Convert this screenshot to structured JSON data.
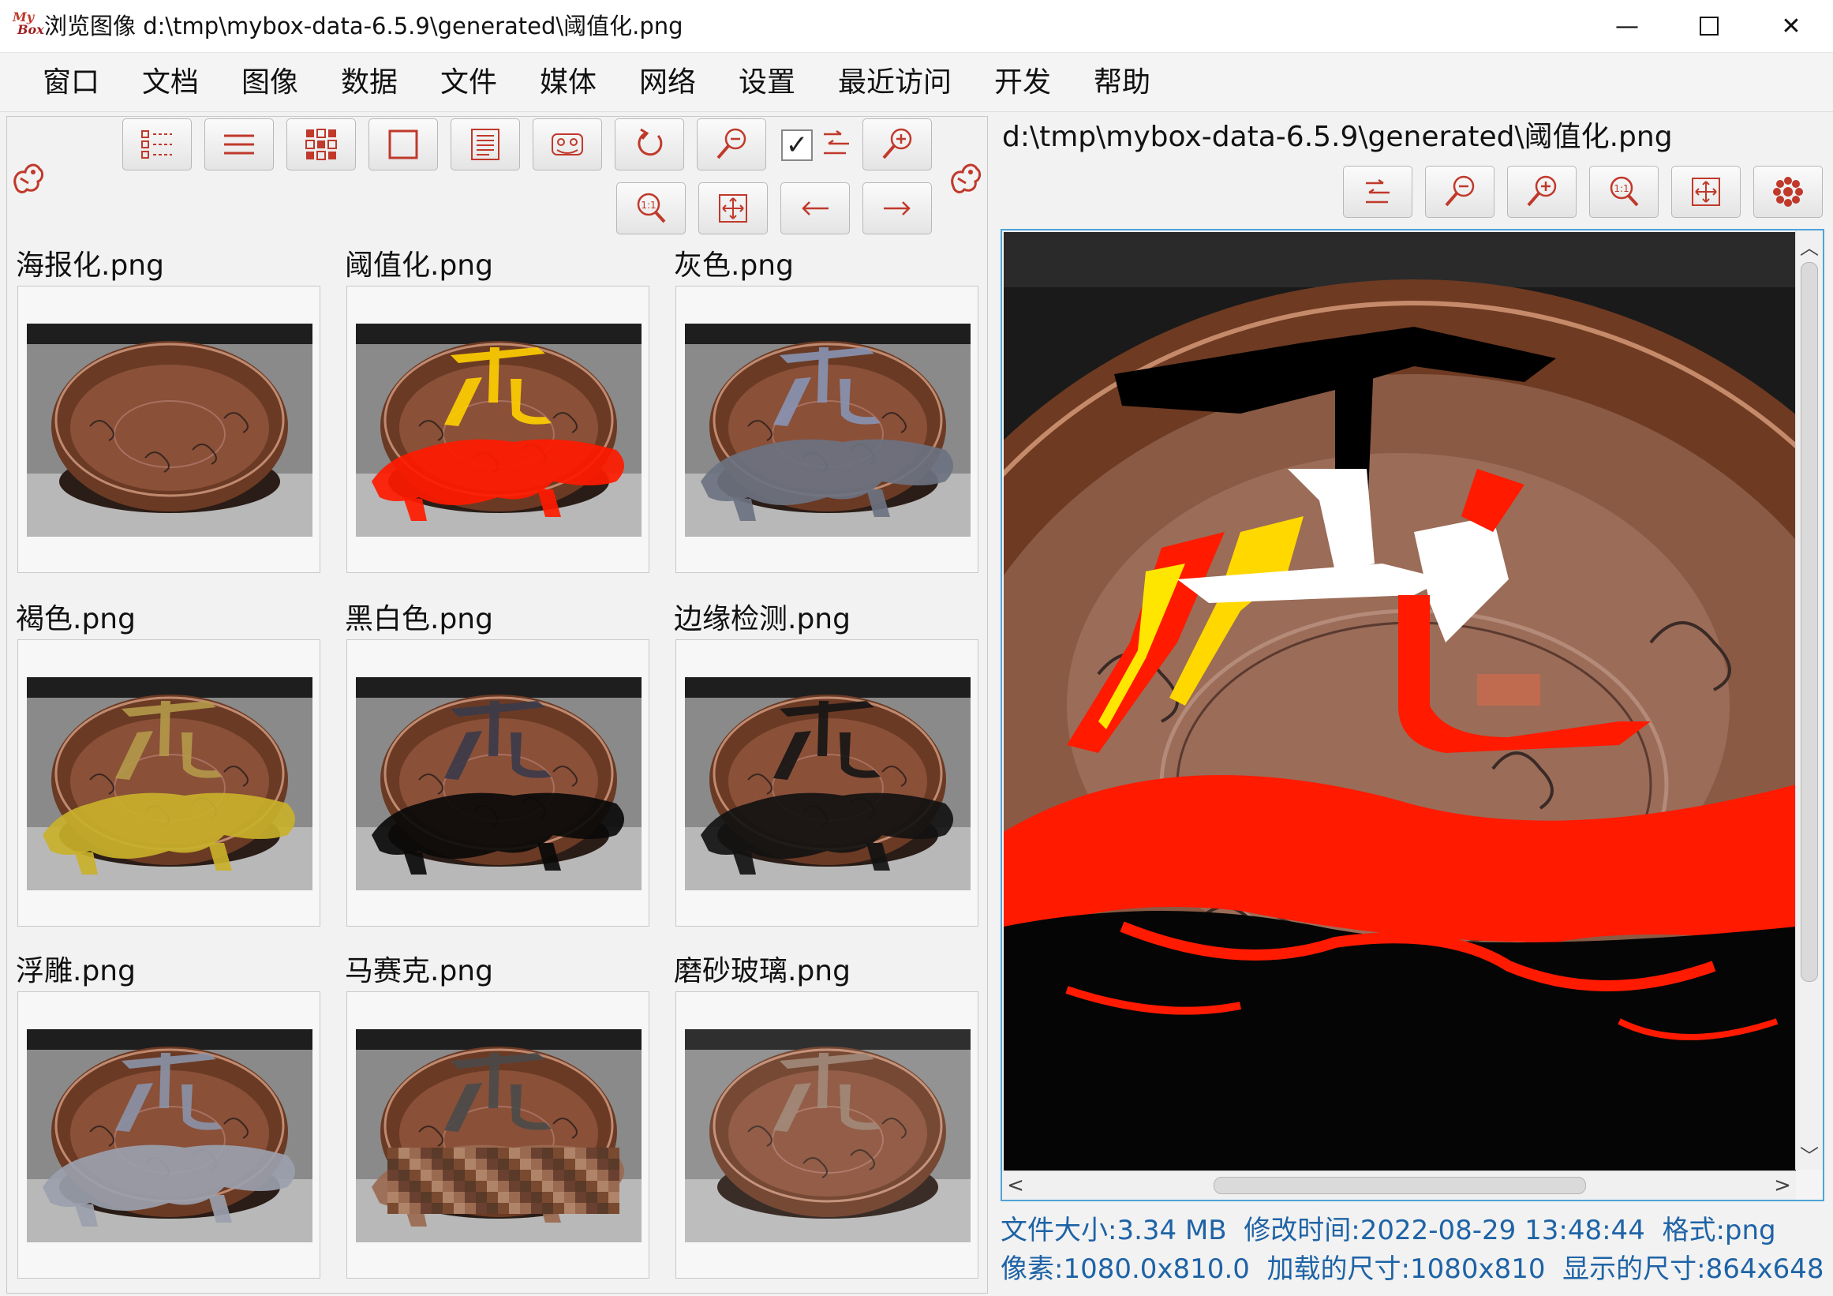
{
  "window": {
    "logo_top": "My",
    "logo_bottom": "Box",
    "title": "浏览图像 d:\\tmp\\mybox-data-6.5.9\\generated\\阈值化.png",
    "minimize": "—",
    "close": "✕"
  },
  "menu": {
    "items": [
      "窗口",
      "文档",
      "图像",
      "数据",
      "文件",
      "媒体",
      "网络",
      "设置",
      "最近访问",
      "开发",
      "帮助"
    ]
  },
  "toolbar": {
    "checkbox_mark": "✓"
  },
  "thumbnails": [
    {
      "name": "海报化.png",
      "variant": "poster"
    },
    {
      "name": "阈值化.png",
      "variant": "threshold"
    },
    {
      "name": "灰色.png",
      "variant": "gray"
    },
    {
      "name": "褐色.png",
      "variant": "sepia"
    },
    {
      "name": "黑白色.png",
      "variant": "bw"
    },
    {
      "name": "边缘检测.png",
      "variant": "edge"
    },
    {
      "name": "浮雕.png",
      "variant": "emboss"
    },
    {
      "name": "马赛克.png",
      "variant": "mosaic"
    },
    {
      "name": "磨砂玻璃.png",
      "variant": "frosted"
    }
  ],
  "viewer": {
    "path": "d:\\tmp\\mybox-data-6.5.9\\generated\\阈值化.png",
    "scroll_up": "︿",
    "scroll_down": "﹀",
    "scroll_left": "<",
    "scroll_right": ">"
  },
  "status": {
    "file_size": "文件大小:3.34 MB",
    "modified": "修改时间:2022-08-29 13:48:44",
    "format": "格式:png",
    "pixels": "像素:1080.0x810.0",
    "loaded_size": "加载的尺寸:1080x810",
    "display_size": "显示的尺寸:864x648"
  },
  "colors": {
    "accent_red": "#c0392b",
    "status_blue": "#1e63a6",
    "focus_border": "#4fa3d9"
  }
}
